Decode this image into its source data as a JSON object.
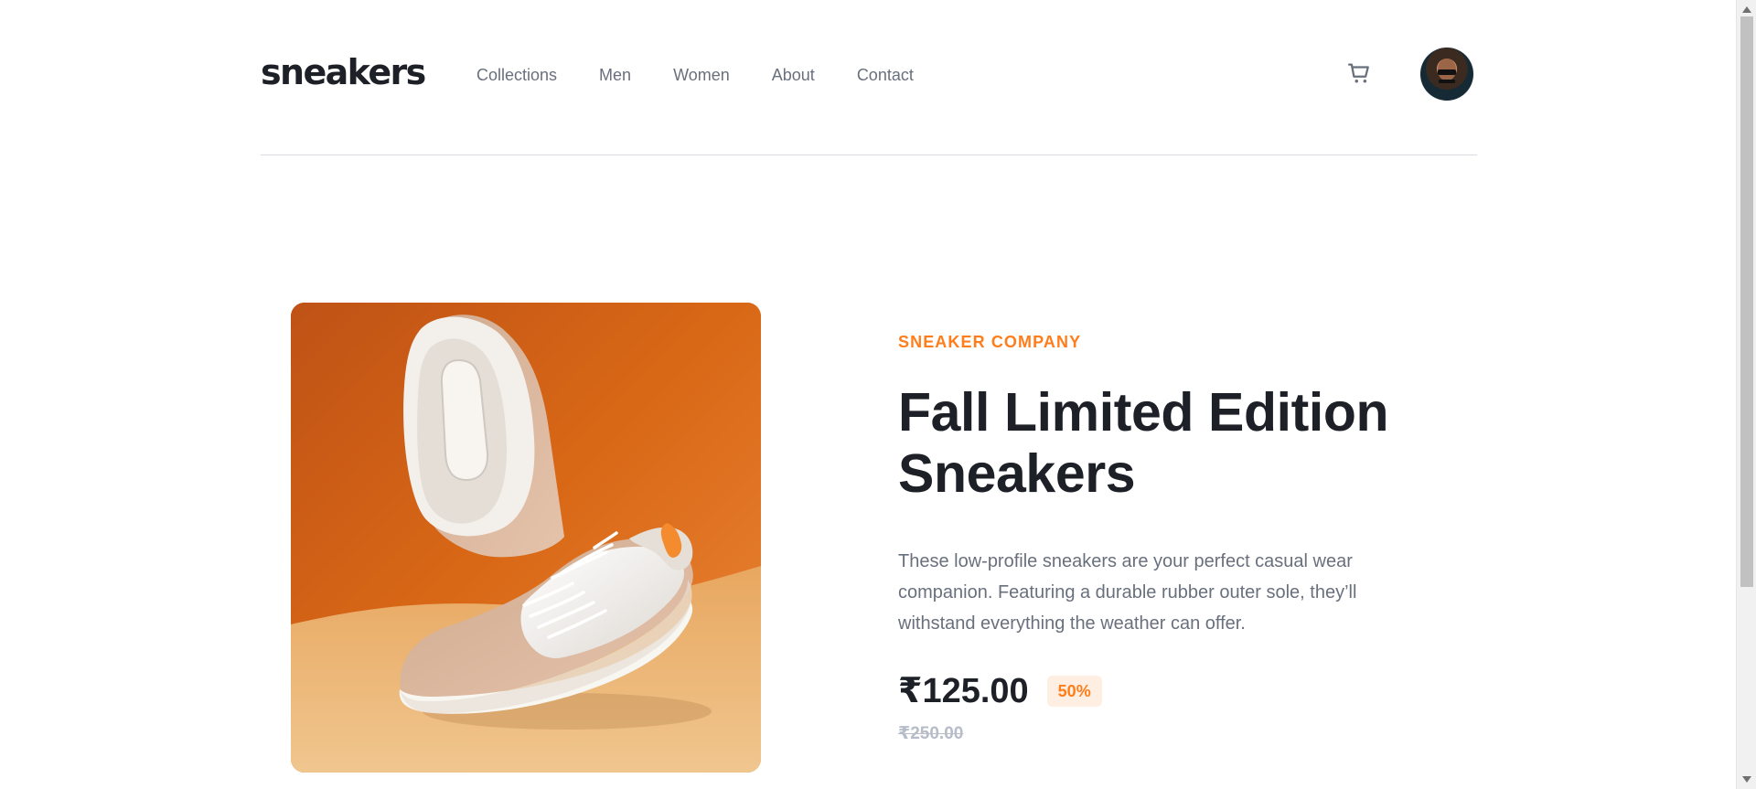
{
  "brand": {
    "logo": "sneakers"
  },
  "nav": {
    "items": [
      "Collections",
      "Men",
      "Women",
      "About",
      "Contact"
    ]
  },
  "header": {
    "cart_icon": "cart-icon",
    "avatar_icon": "avatar"
  },
  "product": {
    "company": "SNEAKER COMPANY",
    "title_line_1": "Fall Limited Edition",
    "title_line_2": "Sneakers",
    "description_lines": [
      "These low-profile sneakers are your perfect casual wear",
      "companion. Featuring a durable rubber outer sole, they’ll",
      "withstand everything the weather can offer."
    ],
    "price": "₹125.00",
    "discount": "50%",
    "old_price": "₹250.00"
  },
  "colors": {
    "accent": "#ff7d1a",
    "accent_soft": "#ffeee2",
    "text_dark": "#1d2026",
    "text_muted": "#69707d",
    "text_light": "#b6bcc8",
    "divider": "#d8dadf"
  }
}
